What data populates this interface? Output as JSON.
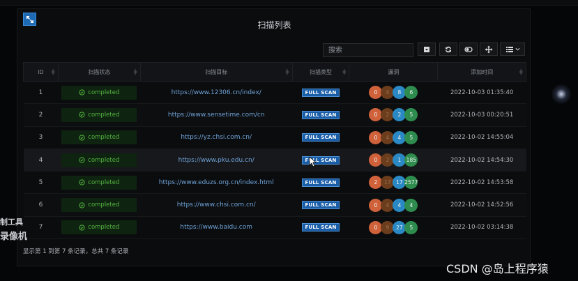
{
  "panel": {
    "title": "扫描列表",
    "search": {
      "placeholder": "搜索",
      "value": ""
    },
    "toolbar": [
      "caret-down-icon",
      "refresh-icon",
      "toggle-icon",
      "move-icon",
      "columns-icon"
    ]
  },
  "table": {
    "headers": [
      "ID",
      "扫描状态",
      "扫描目标",
      "扫描类型",
      "漏洞",
      "添加时间"
    ],
    "rows": [
      {
        "id": "1",
        "status": "completed",
        "target": "https://www.12306.cn/index/",
        "type": "FULL SCAN",
        "vulns": [
          "0",
          "4",
          "8",
          "6"
        ],
        "time": "2022-10-03 01:35:40"
      },
      {
        "id": "2",
        "status": "completed",
        "target": "https://www.sensetime.com/cn",
        "type": "FULL SCAN",
        "vulns": [
          "0",
          "2",
          "2",
          "5"
        ],
        "time": "2022-10-03 00:20:51"
      },
      {
        "id": "3",
        "status": "completed",
        "target": "https://yz.chsi.com.cn/",
        "type": "FULL SCAN",
        "vulns": [
          "0",
          "4",
          "4",
          "5"
        ],
        "time": "2022-10-02 14:55:04"
      },
      {
        "id": "4",
        "status": "completed",
        "target": "https://www.pku.edu.cn/",
        "type": "FULL SCAN",
        "vulns": [
          "0",
          "2",
          "1",
          "185"
        ],
        "time": "2022-10-02 14:54:30"
      },
      {
        "id": "5",
        "status": "completed",
        "target": "https://www.eduzs.org.cn/index.html",
        "type": "FULL SCAN",
        "vulns": [
          "2",
          "17",
          "17",
          "2577"
        ],
        "time": "2022-10-02 14:53:58"
      },
      {
        "id": "6",
        "status": "completed",
        "target": "https://www.chsi.com.cn/",
        "type": "FULL SCAN",
        "vulns": [
          "0",
          "4",
          "4",
          "4"
        ],
        "time": "2022-10-02 14:52:56"
      },
      {
        "id": "7",
        "status": "completed",
        "target": "https://www.baidu.com",
        "type": "FULL SCAN",
        "vulns": [
          "0",
          "9",
          "27",
          "5"
        ],
        "time": "2022-10-02 03:14:38"
      }
    ]
  },
  "footer": {
    "text": "显示第 1 到第 7 条记录，总共 7 条记录"
  },
  "watermarks": {
    "left_line1": "制工具",
    "left_line2": "录像机",
    "right": "CSDN @岛上程序猿"
  },
  "colors": {
    "accent": "#1f6bb3",
    "status_green": "#55b441",
    "critical": "#d0623b",
    "high": "#6b3d1c",
    "medium": "#2a89c4",
    "low": "#2e8d4e"
  }
}
